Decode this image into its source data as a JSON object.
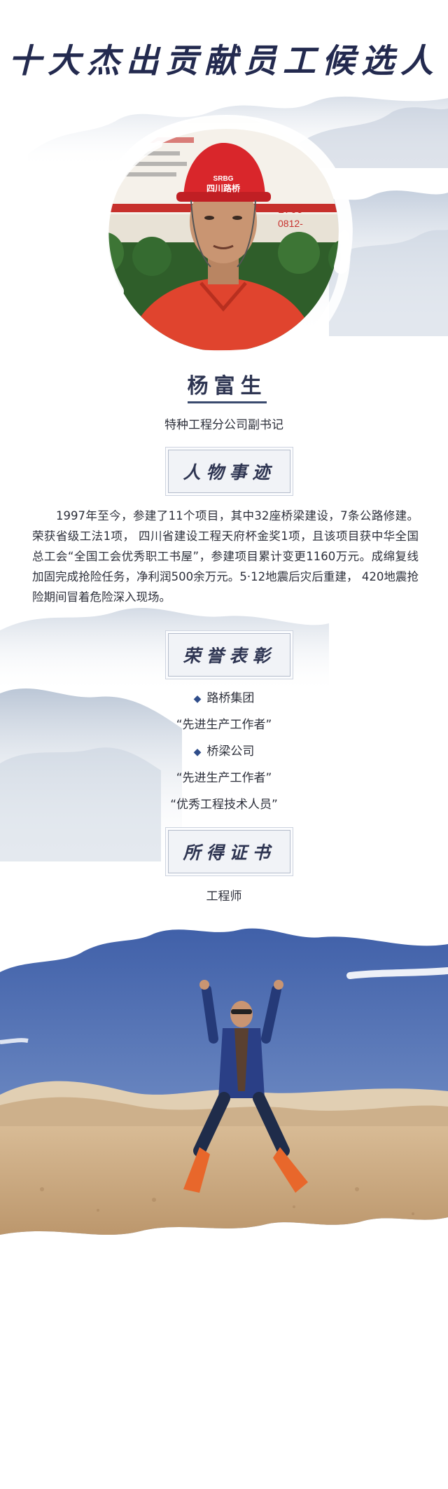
{
  "title": "十大杰出贡献员工候选人",
  "profile": {
    "name": "杨富生",
    "role": "特种工程分公司副书记",
    "helmet_text": "四川路桥",
    "helmet_logo": "SRBG",
    "sign_numbers": [
      "1760",
      "0812-"
    ]
  },
  "sections": {
    "story_heading": "人物事迹",
    "honor_heading": "荣誉表彰",
    "cert_heading": "所得证书"
  },
  "story": "1997年至今，参建了11个项目，其中32座桥梁建设，7条公路修建。荣获省级工法1项，  四川省建设工程天府杯金奖1项，且该项目获中华全国总工会“全国工会优秀职工书屋”，参建项目累计变更1160万元。成绵复线加固完成抢险任务，净利润500余万元。5·12地震后灾后重建， 420地震抢险期间冒着危险深入现场。",
  "honors": [
    {
      "org": "路桥集团",
      "titles": [
        "“先进生产工作者”"
      ]
    },
    {
      "org": "桥梁公司",
      "titles": [
        "“先进生产工作者”",
        "“优秀工程技术人员”"
      ]
    }
  ],
  "certificate": "工程师",
  "colors": {
    "title": "#232a4f",
    "accent": "#2f4d8a",
    "shirt": "#e0442e",
    "helmet": "#d9262b",
    "sky": "#4f6fb6",
    "sand": "#c9a47a"
  }
}
